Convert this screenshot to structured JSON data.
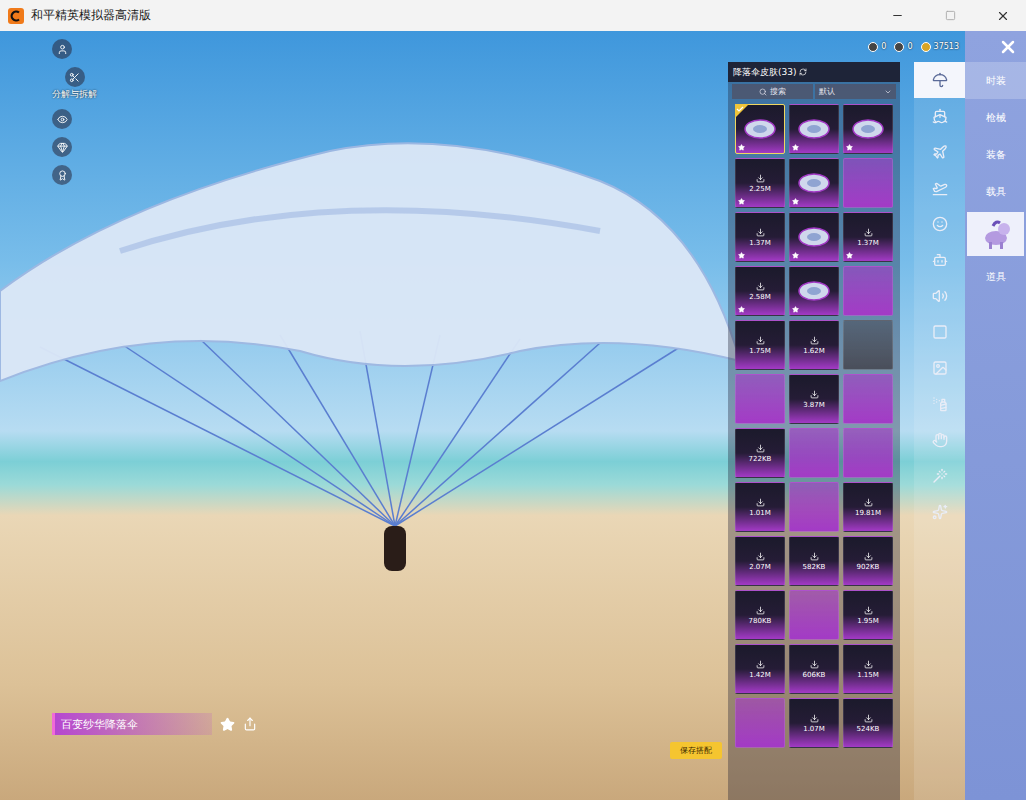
{
  "window": {
    "title": "和平精英模拟器高清版"
  },
  "tools": [
    {
      "kind": "icon"
    },
    {
      "kind": "labeled",
      "label": "分解与拆解"
    },
    {
      "kind": "icon"
    },
    {
      "kind": "icon"
    },
    {
      "kind": "icon"
    }
  ],
  "currency": [
    {
      "amount": "0"
    },
    {
      "amount": "0"
    },
    {
      "amount": "37513"
    }
  ],
  "panel": {
    "title": "降落伞皮肤(33)",
    "search": {
      "placeholder": "搜索"
    },
    "sort": {
      "value": "默认"
    }
  },
  "items": [
    {
      "kind": "art",
      "selected": true,
      "starred": true,
      "color": "#a33ac6"
    },
    {
      "kind": "art",
      "selected": false,
      "starred": true,
      "color": "#a33ac6"
    },
    {
      "kind": "art",
      "selected": false,
      "starred": true,
      "color": "#a33ac6"
    },
    {
      "kind": "download",
      "size": "2.25M",
      "selected": false,
      "starred": true,
      "color": "#a33ac6"
    },
    {
      "kind": "art",
      "selected": false,
      "starred": true,
      "color": "#a33ac6"
    },
    {
      "kind": "empty",
      "selected": false,
      "starred": false,
      "color": "#a33ac6"
    },
    {
      "kind": "download",
      "size": "1.37M",
      "selected": false,
      "starred": true,
      "color": "#a33ac6"
    },
    {
      "kind": "art",
      "selected": false,
      "starred": true,
      "color": "#a33ac6"
    },
    {
      "kind": "download",
      "size": "1.37M",
      "selected": false,
      "starred": true,
      "color": "#a33ac6"
    },
    {
      "kind": "download",
      "size": "2.58M",
      "selected": false,
      "starred": true,
      "color": "#a33ac6"
    },
    {
      "kind": "art",
      "selected": false,
      "starred": true,
      "color": "#a33ac6"
    },
    {
      "kind": "empty",
      "selected": false,
      "starred": false,
      "color": "#a33ac6"
    },
    {
      "kind": "download",
      "size": "1.75M",
      "selected": false,
      "starred": false,
      "color": "#a33ac6"
    },
    {
      "kind": "download",
      "size": "1.62M",
      "selected": false,
      "starred": false,
      "color": "#a33ac6"
    },
    {
      "kind": "empty",
      "selected": false,
      "starred": false,
      "color": "#4a4e5a"
    },
    {
      "kind": "empty",
      "selected": false,
      "starred": false,
      "color": "#a33ac6"
    },
    {
      "kind": "download",
      "size": "3.87M",
      "selected": false,
      "starred": false,
      "color": "#a33ac6"
    },
    {
      "kind": "empty",
      "selected": false,
      "starred": false,
      "color": "#a33ac6"
    },
    {
      "kind": "download",
      "size": "722KB",
      "selected": false,
      "starred": false,
      "color": "#a33ac6"
    },
    {
      "kind": "empty",
      "selected": false,
      "starred": false,
      "color": "#a33ac6"
    },
    {
      "kind": "empty",
      "selected": false,
      "starred": false,
      "color": "#a33ac6"
    },
    {
      "kind": "download",
      "size": "1.01M",
      "selected": false,
      "starred": false,
      "color": "#a33ac6"
    },
    {
      "kind": "empty",
      "selected": false,
      "starred": false,
      "color": "#a33ac6"
    },
    {
      "kind": "download",
      "size": "19.81M",
      "selected": false,
      "starred": false,
      "color": "#a33ac6"
    },
    {
      "kind": "download",
      "size": "2.07M",
      "selected": false,
      "starred": false,
      "color": "#a33ac6"
    },
    {
      "kind": "download",
      "size": "582KB",
      "selected": false,
      "starred": false,
      "color": "#a33ac6"
    },
    {
      "kind": "download",
      "size": "902KB",
      "selected": false,
      "starred": false,
      "color": "#a33ac6"
    },
    {
      "kind": "download",
      "size": "780KB",
      "selected": false,
      "starred": false,
      "color": "#a33ac6"
    },
    {
      "kind": "empty",
      "selected": false,
      "starred": false,
      "color": "#a33ac6"
    },
    {
      "kind": "download",
      "size": "1.95M",
      "selected": false,
      "starred": false,
      "color": "#a33ac6"
    },
    {
      "kind": "download",
      "size": "1.42M",
      "selected": false,
      "starred": false,
      "color": "#a33ac6"
    },
    {
      "kind": "download",
      "size": "606KB",
      "selected": false,
      "starred": false,
      "color": "#a33ac6"
    },
    {
      "kind": "download",
      "size": "1.15M",
      "selected": false,
      "starred": false,
      "color": "#a33ac6"
    },
    {
      "kind": "empty",
      "selected": false,
      "starred": false,
      "color": "#a33ac6"
    },
    {
      "kind": "download",
      "size": "1.07M",
      "selected": false,
      "starred": false,
      "color": "#a33ac6"
    },
    {
      "kind": "download",
      "size": "524KB",
      "selected": false,
      "starred": false,
      "color": "#a33ac6"
    }
  ],
  "categories": [
    {
      "selected": true
    },
    {
      "selected": false
    },
    {
      "selected": false
    },
    {
      "selected": false
    },
    {
      "selected": false
    },
    {
      "selected": false
    },
    {
      "selected": false
    },
    {
      "selected": false
    },
    {
      "selected": false
    },
    {
      "selected": false
    },
    {
      "selected": false
    },
    {
      "selected": false
    },
    {
      "selected": false
    }
  ],
  "tabs": [
    {
      "kind": "text",
      "label": "时装",
      "selected": true
    },
    {
      "kind": "text",
      "label": "枪械",
      "selected": false
    },
    {
      "kind": "text",
      "label": "装备",
      "selected": false
    },
    {
      "kind": "text",
      "label": "载具",
      "selected": false
    },
    {
      "kind": "image",
      "selected": false
    },
    {
      "kind": "text",
      "label": "道具",
      "selected": false
    }
  ],
  "equipped": {
    "name": "百变纱华降落伞",
    "favorite": false
  },
  "save_button": "保存搭配"
}
